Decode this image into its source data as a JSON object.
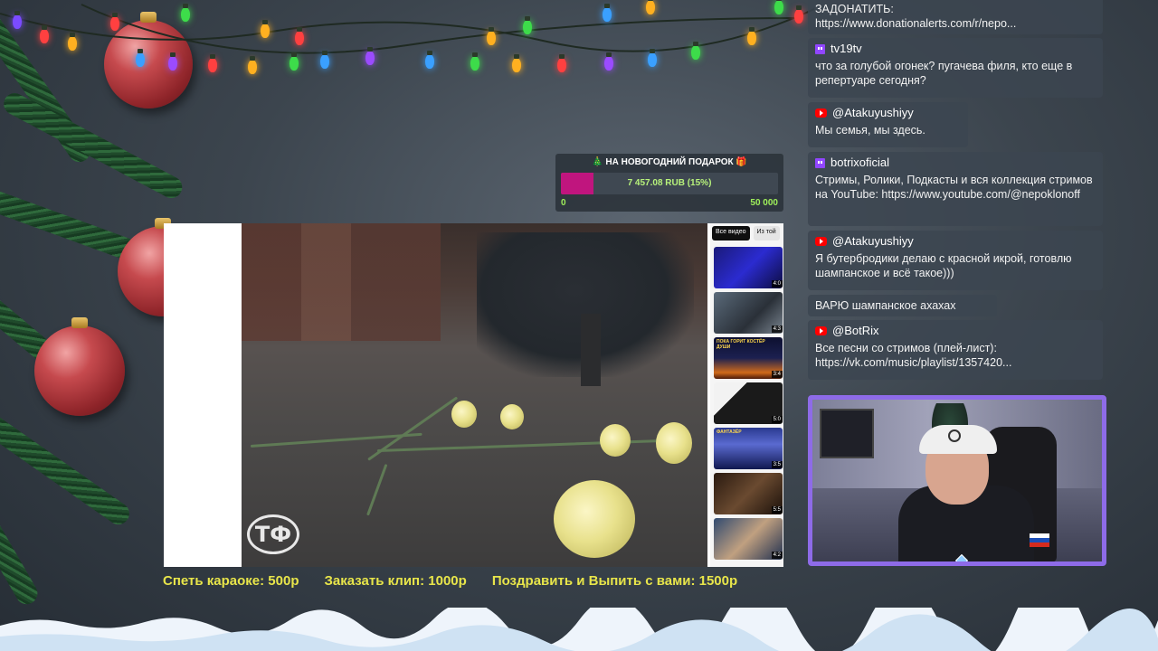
{
  "donation_goal": {
    "title": "🎄 НА НОВОГОДНИЙ ПОДАРОК 🎁",
    "amount_label": "7 457.08 RUB (15%)",
    "min_label": "0",
    "max_label": "50 000",
    "progress_fraction": 0.15,
    "fill_color": "#c0157e"
  },
  "video": {
    "logo_text": "ТФ",
    "sidebar": {
      "chips": [
        "Все видео",
        "Из той"
      ],
      "thumbnails": [
        {
          "duration": "4:0",
          "caption": ""
        },
        {
          "duration": "4:3",
          "caption": ""
        },
        {
          "duration": "3:4",
          "caption": "ПОКА ГОРИТ КОСТЁР ДУШИ"
        },
        {
          "duration": "5:0",
          "caption": ""
        },
        {
          "duration": "3:5",
          "caption": "ФАНТАЗЁР"
        },
        {
          "duration": "5:5",
          "caption": ""
        },
        {
          "duration": "4:2",
          "caption": ""
        }
      ]
    }
  },
  "price_bar": {
    "karaoke": "Спеть караоке: 500р",
    "clip": "Заказать клип: 1000р",
    "congrats": "Поздравить и Выпить с вами: 1500р"
  },
  "chat": {
    "messages": [
      {
        "platform": "none",
        "author": "",
        "text": "ЗАДОНАТИТЬ: https://www.donationalerts.com/r/nepo..."
      },
      {
        "platform": "twitch",
        "author": "tv19tv",
        "text": "что за голубой огонек? пугачева филя, кто еще в репертуаре сегодня?"
      },
      {
        "platform": "youtube",
        "author": "@Atakuyushiyy",
        "text": "Мы семья, мы здесь."
      },
      {
        "platform": "twitch",
        "author": "botrixoficial",
        "text": "Стримы, Ролики, Подкасты и вся коллекция стримов на YouTube: https://www.youtube.com/@nepoklonoff"
      },
      {
        "platform": "youtube",
        "author": "@Atakuyushiyy",
        "text": "Я бутербродики делаю с красной икрой, готовлю шампанское и всё такое)))"
      },
      {
        "platform": "none",
        "author": "",
        "text": "ВАРЮ шампанское ахахах"
      },
      {
        "platform": "youtube",
        "author": "@BotRix",
        "text": "Все песни со стримов (плей-лист): https://vk.com/music/playlist/1357420..."
      }
    ]
  },
  "webcam": {
    "border_color": "#8e6be8"
  },
  "colors": {
    "price_text": "#e8e54a",
    "goal_amount": "#b7f27b",
    "twitch": "#9146ff",
    "youtube": "#ff0000"
  }
}
